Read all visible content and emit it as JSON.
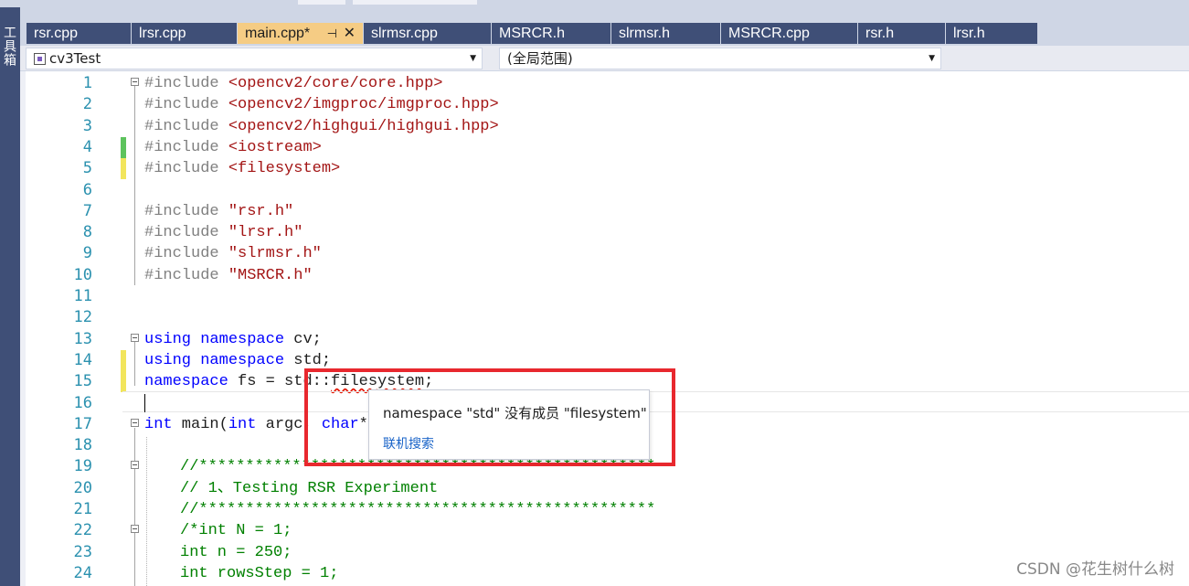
{
  "sidebar": {
    "toolbox_label": "工具箱"
  },
  "tabs": [
    {
      "label": "rsr.cpp",
      "active": false
    },
    {
      "label": "lrsr.cpp",
      "active": false
    },
    {
      "label": "main.cpp*",
      "active": true
    },
    {
      "label": "slrmsr.cpp",
      "active": false
    },
    {
      "label": "MSRCR.h",
      "active": false
    },
    {
      "label": "slrmsr.h",
      "active": false
    },
    {
      "label": "MSRCR.cpp",
      "active": false
    },
    {
      "label": "rsr.h",
      "active": false
    },
    {
      "label": "lrsr.h",
      "active": false
    }
  ],
  "tab_icons": {
    "pin": "pin-icon",
    "close": "close-icon"
  },
  "navbar": {
    "project": "cv3Test",
    "scope": "(全局范围)"
  },
  "editor": {
    "line_numbers": [
      "1",
      "2",
      "3",
      "4",
      "5",
      "6",
      "7",
      "8",
      "9",
      "10",
      "11",
      "12",
      "13",
      "14",
      "15",
      "16",
      "17",
      "18",
      "19",
      "20",
      "21",
      "22",
      "23",
      "24"
    ],
    "lines": {
      "l1": [
        "#include ",
        "<opencv2/core/core.hpp>"
      ],
      "l2": [
        "#include ",
        "<opencv2/imgproc/imgproc.hpp>"
      ],
      "l3": [
        "#include ",
        "<opencv2/highgui/highgui.hpp>"
      ],
      "l4": [
        "#include ",
        "<iostream>"
      ],
      "l5": [
        "#include ",
        "<filesystem>"
      ],
      "l7": [
        "#include ",
        "\"rsr.h\""
      ],
      "l8": [
        "#include ",
        "\"lrsr.h\""
      ],
      "l9": [
        "#include ",
        "\"slrmsr.h\""
      ],
      "l10": [
        "#include ",
        "\"MSRCR.h\""
      ],
      "l13": [
        "using",
        " ",
        "namespace",
        " cv;"
      ],
      "l14": [
        "using",
        " ",
        "namespace",
        " std;"
      ],
      "l15": [
        "namespace",
        " fs = std::",
        "filesystem",
        ";"
      ],
      "l17": [
        "int",
        " main(",
        "int",
        " argc, ",
        "char",
        "**"
      ],
      "l19": "//*************************************************",
      "l20": "// 1、Testing RSR Experiment",
      "l21": "//*************************************************",
      "l22": "/*int N = 1;",
      "l23": "int n = 250;",
      "l24": "int rowsStep = 1;"
    }
  },
  "tooltip": {
    "message": "namespace \"std\" 没有成员 \"filesystem\"",
    "link": "联机搜索"
  },
  "watermark": "CSDN @花生树什么树",
  "colors": {
    "tab_bg": "#3f4f77",
    "tab_active_bg": "#f5cc84",
    "keyword": "#0000ff",
    "string": "#a31515",
    "comment": "#008000",
    "line_number": "#2b91af",
    "highlight_box": "#e8282e",
    "saved_change": "#5dc35d",
    "unsaved_change": "#f2e55c"
  }
}
